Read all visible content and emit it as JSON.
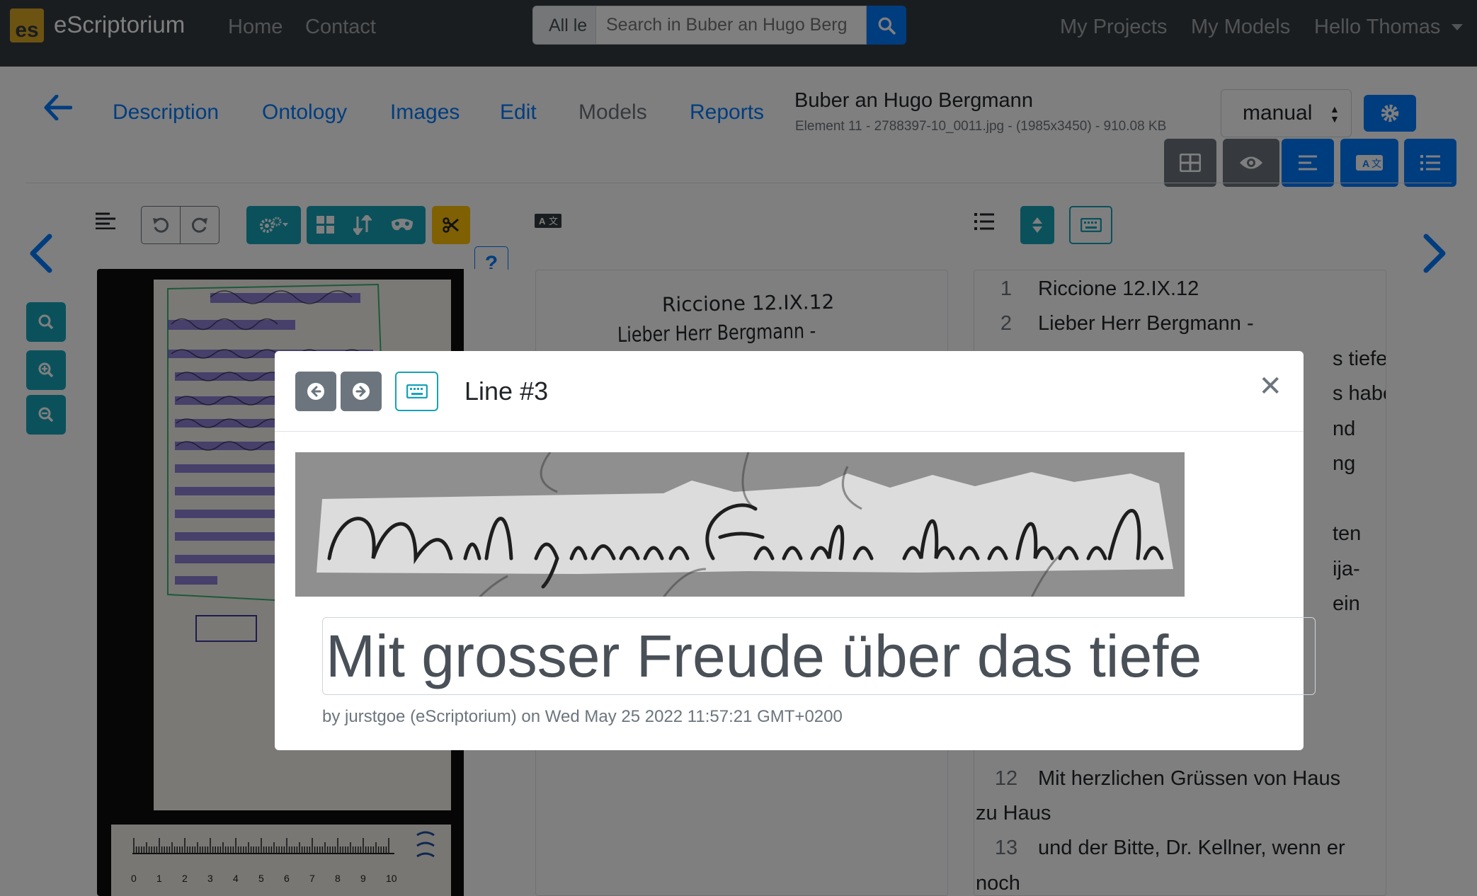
{
  "navbar": {
    "brand_logo_text": "es",
    "brand_name": "eScriptorium",
    "links": [
      "Home",
      "Contact"
    ],
    "search_scope": "All le",
    "search_placeholder": "Search in Buber an Hugo Berg",
    "right_links": [
      "My Projects",
      "My Models",
      "Hello Thomas"
    ]
  },
  "toolbar": {
    "tabs": [
      {
        "label": "Description",
        "active": true
      },
      {
        "label": "Ontology",
        "active": true
      },
      {
        "label": "Images",
        "active": true
      },
      {
        "label": "Edit",
        "active": true
      },
      {
        "label": "Models",
        "active": false
      },
      {
        "label": "Reports",
        "active": true
      }
    ],
    "doc_title": "Buber an Hugo Bergmann",
    "doc_subtitle": "Element 11 - 2788397-10_0011.jpg - (1985x3450) - 910.08 KB",
    "mode_select": "manual",
    "help_glyph": "?"
  },
  "source_panel": {
    "lines": [
      "Riccione 12.IX.12",
      "Lieber Herr Bergmann -"
    ],
    "ruler_ticks": [
      "0",
      "1",
      "2",
      "3",
      "4",
      "5",
      "6",
      "7",
      "8",
      "9",
      "10"
    ]
  },
  "text_panel": {
    "lines": [
      {
        "num": "1",
        "text": "Riccione 12.IX.12"
      },
      {
        "num": "2",
        "text": "Lieber Herr Bergmann -"
      },
      {
        "num": "",
        "text": "s tiefe"
      },
      {
        "num": "",
        "text": "s habe"
      },
      {
        "num": "",
        "text": "nd"
      },
      {
        "num": "",
        "text": "ng"
      },
      {
        "num": "",
        "text": "ten"
      },
      {
        "num": "",
        "text": "ija-"
      },
      {
        "num": "",
        "text": "ein"
      },
      {
        "num": "12",
        "text": "Mit herzlichen Grüssen von Haus"
      },
      {
        "num": "",
        "text": "zu Haus"
      },
      {
        "num": "13",
        "text": "und der Bitte, Dr. Kellner, wenn er"
      },
      {
        "num": "",
        "text": "noch"
      }
    ]
  },
  "modal": {
    "title": "Line #3",
    "transcription": "Mit grosser Freude über das tiefe",
    "byline": "by jurstgoe (eScriptorium) on Wed May 25 2022 11:57:21 GMT+0200"
  },
  "colors": {
    "navbar": "#343a40",
    "primary": "#007bff",
    "teal": "#17a2b8",
    "secondary": "#6c757d",
    "warning": "#ffc107"
  }
}
